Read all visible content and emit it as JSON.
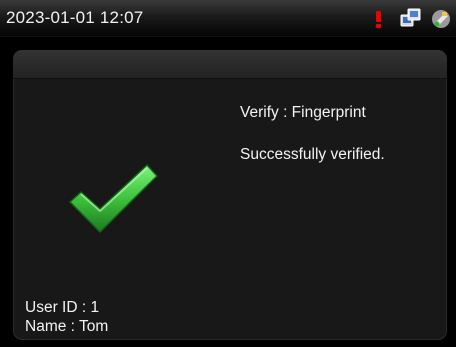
{
  "status_bar": {
    "datetime": "2023-01-01 12:07",
    "icons": [
      "alert-icon",
      "network-icon",
      "usb-icon"
    ]
  },
  "result": {
    "verify_text": "Verify : Fingerprint",
    "message": "Successfully verified.",
    "icon": "checkmark-icon",
    "colors": {
      "check_green": "#3ec23e",
      "check_dark": "#1d7a1d"
    }
  },
  "user": {
    "id_text": "User ID : 1",
    "name_text": "Name : Tom"
  }
}
